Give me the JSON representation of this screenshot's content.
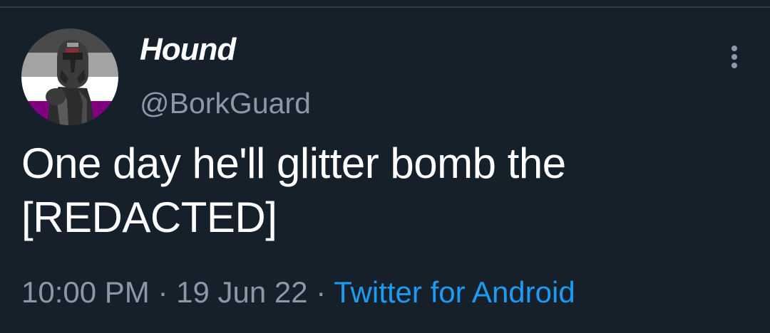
{
  "tweet": {
    "author": {
      "display_name": "Hound",
      "handle": "@BorkGuard",
      "avatar_icon": "clone-trooper-avatar"
    },
    "text_line1": "One day he'll glitter bomb the",
    "text_line2": "[REDACTED]",
    "time": "10:00 PM",
    "separator": "·",
    "date": "19 Jun 22",
    "source": "Twitter for Android",
    "more_icon": "more-vertical-icon"
  },
  "colors": {
    "background": "#15202b",
    "text_primary": "#ffffff",
    "text_secondary": "#8b98a5",
    "link": "#1d9bf0",
    "avatar_stripes": [
      "#4a4a4a",
      "#a3a3a3",
      "#ffffff",
      "#800080"
    ]
  }
}
